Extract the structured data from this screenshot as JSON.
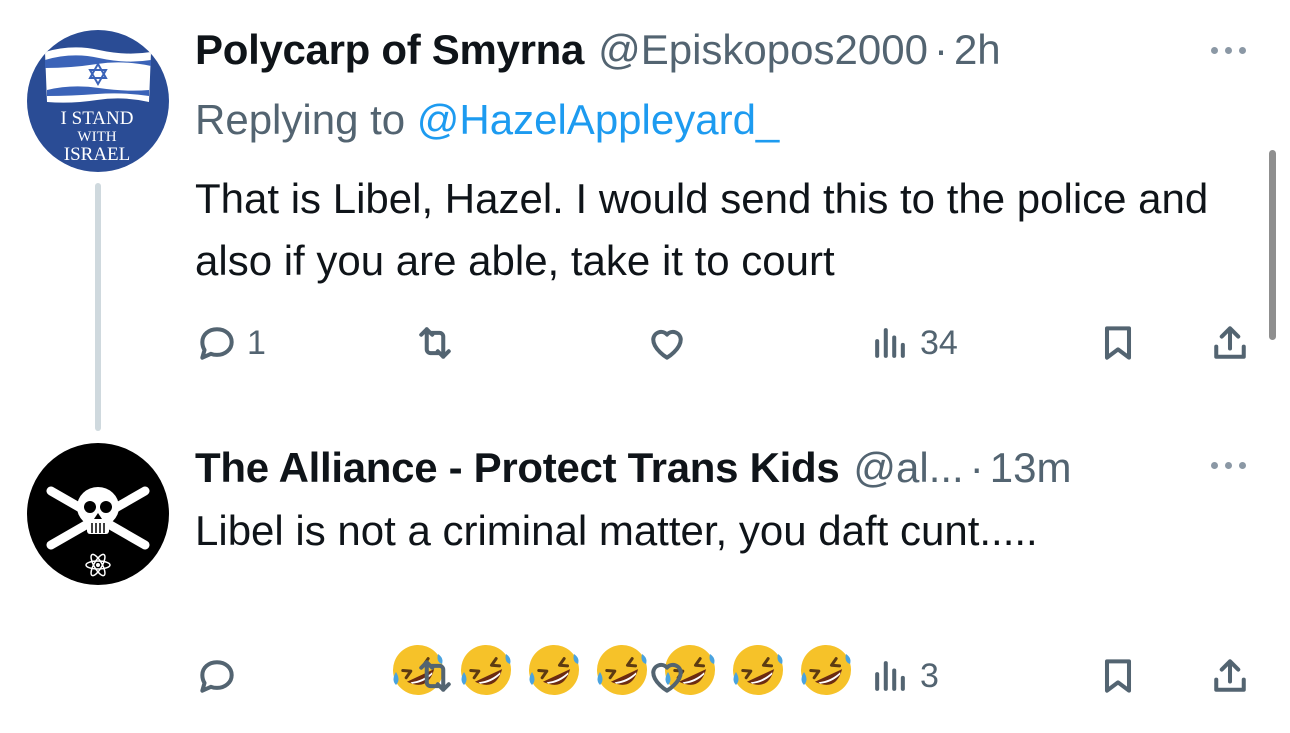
{
  "tweets": [
    {
      "display_name": "Polycarp of Smyrna",
      "handle": "@Episkopos2000",
      "separator": "·",
      "time": "2h",
      "replying_prefix": "Replying to",
      "replying_to": "@HazelAppleyard_",
      "text": "That is Libel, Hazel. I would send this to the police and also if you are able, take it to court",
      "avatar": {
        "lines": [
          "I STAND",
          "WITH",
          "ISRAEL"
        ]
      },
      "counts": {
        "replies": "1",
        "retweets": "",
        "likes": "",
        "views": "34"
      }
    },
    {
      "display_name": "The Alliance - Protect Trans Kids",
      "handle": "@al...",
      "separator": "·",
      "time": "13m",
      "text": "Libel is not a criminal matter, you daft cunt.....",
      "emoji": [
        "rofl",
        "rofl",
        "rofl",
        "rofl",
        "rofl",
        "rofl",
        "rofl"
      ],
      "counts": {
        "replies": "",
        "retweets": "",
        "likes": "",
        "views": "3"
      }
    }
  ],
  "colors": {
    "text": "#0f1419",
    "secondary": "#536471",
    "link": "#1d9bf0",
    "thread_line": "#cfd9de"
  },
  "icons": [
    "reply-icon",
    "retweet-icon",
    "like-icon",
    "views-icon",
    "bookmark-icon",
    "share-icon",
    "more-icon"
  ]
}
